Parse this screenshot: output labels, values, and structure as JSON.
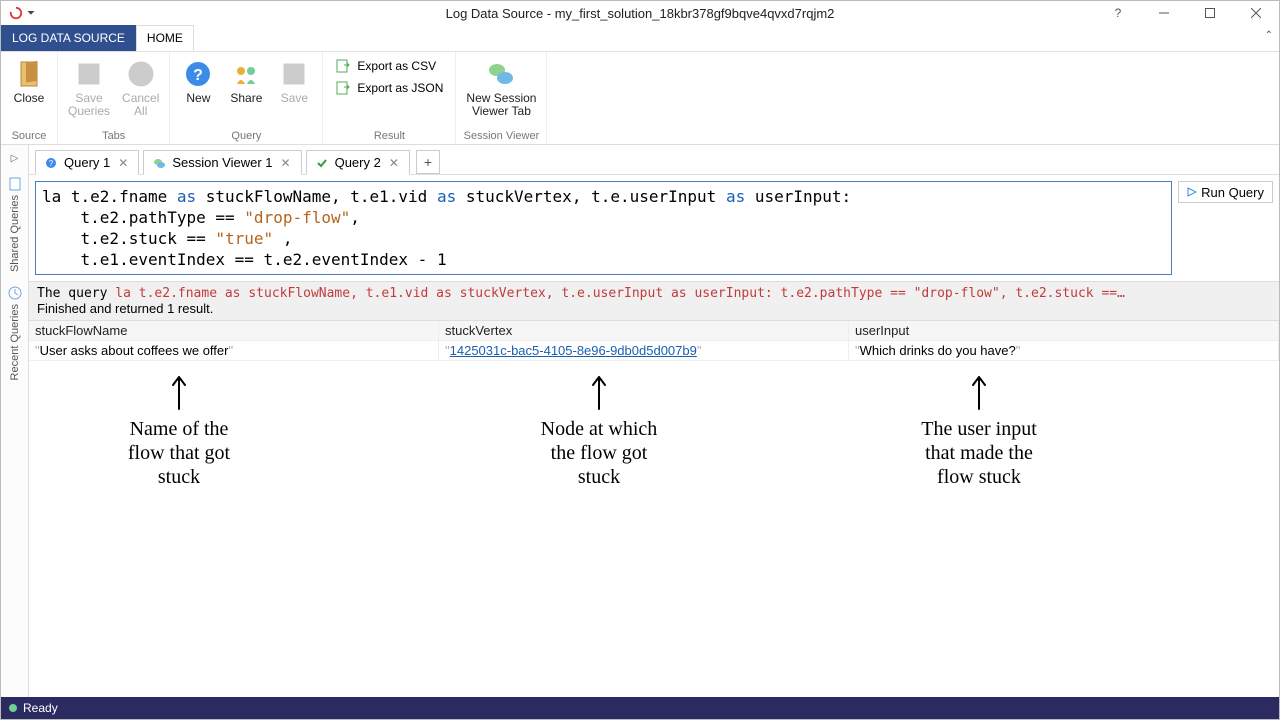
{
  "title": "Log Data Source - my_first_solution_18kbr378gf9bqve4qvxd7rqjm2",
  "ribbon_tabs": {
    "context": "LOG DATA SOURCE",
    "home": "HOME"
  },
  "ribbon": {
    "source": {
      "close": "Close",
      "group": "Source"
    },
    "tabs": {
      "save_queries": "Save\nQueries",
      "cancel_all": "Cancel\nAll",
      "group": "Tabs"
    },
    "query": {
      "new": "New",
      "share": "Share",
      "save": "Save",
      "group": "Query"
    },
    "result": {
      "csv": "Export as CSV",
      "json": "Export as JSON",
      "group": "Result"
    },
    "session": {
      "btn": "New Session\nViewer Tab",
      "group": "Session Viewer"
    }
  },
  "sidebar": {
    "shared": "Shared Queries",
    "recent": "Recent Queries"
  },
  "doctabs": {
    "q1": "Query 1",
    "sv1": "Session Viewer 1",
    "q2": "Query 2"
  },
  "editor": {
    "l1a": "la t.e2.fname ",
    "l1b": "as",
    "l1c": " stuckFlowName, t.e1.vid ",
    "l1d": "as",
    "l1e": " stuckVertex, t.e.userInput ",
    "l1f": "as",
    "l1g": " userInput:",
    "l2a": "    t.e2.pathType == ",
    "l2b": "\"drop-flow\"",
    "l2c": ",",
    "l3a": "    t.e2.stuck == ",
    "l3b": "\"true\"",
    "l3c": " ,",
    "l4": "    t.e1.eventIndex == t.e2.eventIndex - 1"
  },
  "run": "Run Query",
  "output": {
    "prefix": "The query ",
    "query": "la t.e2.fname as stuckFlowName, t.e1.vid as stuckVertex, t.e.userInput as userInput:        t.e2.pathType == \"drop-flow\",        t.e2.stuck ==…",
    "status": "Finished and returned 1 result."
  },
  "table": {
    "headers": {
      "c1": "stuckFlowName",
      "c2": "stuckVertex",
      "c3": "userInput"
    },
    "row": {
      "c1": "User asks about coffees we offer",
      "c2": "1425031c-bac5-4105-8e96-9db0d5d007b9",
      "c3": "Which drinks do you have?"
    }
  },
  "annotations": {
    "a1": "Name of the\nflow that got\nstuck",
    "a2": "Node at which\nthe flow got\nstuck",
    "a3": "The user input\nthat made the\nflow stuck"
  },
  "status": "Ready"
}
